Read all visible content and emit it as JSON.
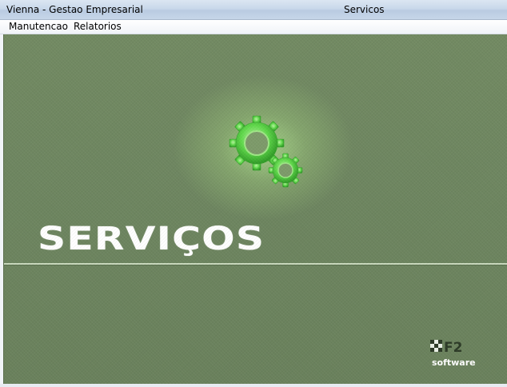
{
  "window": {
    "app_title": "Vienna - Gestao Empresarial",
    "screen_title": "Servicos"
  },
  "menu": {
    "items": [
      {
        "label": "Manutencao"
      },
      {
        "label": "Relatorios"
      }
    ]
  },
  "content": {
    "heading": "SERVIÇOS",
    "icon": "gears-icon",
    "brand_logo_text": "F2",
    "brand_subtext": "software"
  },
  "colors": {
    "background_green": "#6e8660",
    "glow_green": "#a8d68a",
    "gear_green": "#5fd84a",
    "heading": "#ffffff"
  }
}
